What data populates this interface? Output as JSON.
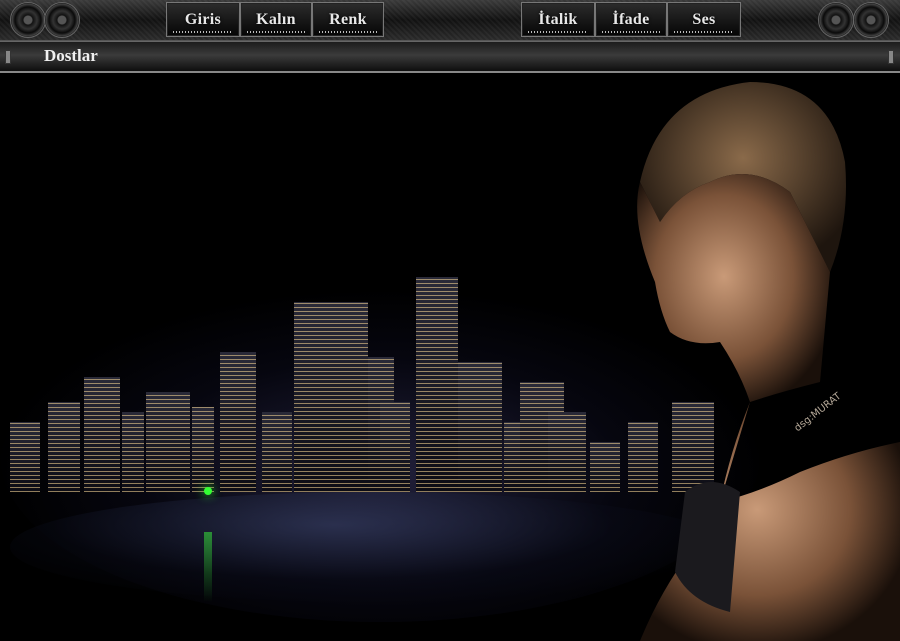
{
  "toolbar": {
    "buttons": [
      "Giris",
      "Kalın",
      "Renk",
      "İtalik",
      "İfade",
      "Ses"
    ]
  },
  "nav": {
    "title": "Dostlar"
  },
  "signature": "dsg:MURAT",
  "colors": {
    "background": "#000000",
    "bar": "#1e1e1e",
    "text": "#e8e8e8"
  },
  "icons": [
    "speaker-icon",
    "speaker-icon",
    "speaker-icon",
    "speaker-icon"
  ]
}
